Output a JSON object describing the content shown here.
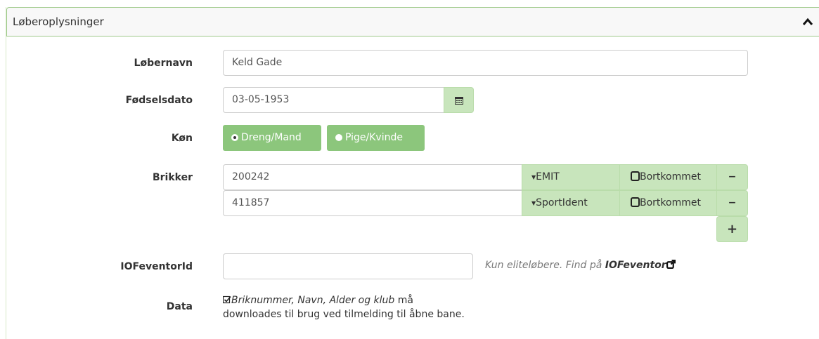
{
  "panel": {
    "title": "Løberoplysninger",
    "collapse_icon": "chevron-up-icon"
  },
  "form": {
    "runner_name": {
      "label": "Løbernavn",
      "value": "Keld Gade"
    },
    "birthdate": {
      "label": "Fødselsdato",
      "value": "03-05-1953",
      "icon": "calendar-icon"
    },
    "gender": {
      "label": "Køn",
      "options": [
        {
          "label": "Dreng/Mand",
          "checked": true
        },
        {
          "label": "Pige/Kvinde",
          "checked": false
        }
      ]
    },
    "chips": {
      "label": "Brikker",
      "rows": [
        {
          "number": "200242",
          "type": "EMIT",
          "lost_label": "Bortkommet"
        },
        {
          "number": "411857",
          "type": "SportIdent",
          "lost_label": "Bortkommet"
        }
      ],
      "remove_symbol": "−",
      "add_symbol": "+"
    },
    "ioffeventor": {
      "label": "IOFeventorId",
      "value": "",
      "help_prefix": "Kun eliteløbere. Find på ",
      "help_link": "IOFeventor"
    },
    "data": {
      "label": "Data",
      "consent_emphasis": "Briknummer, Navn, Alder og klub",
      "consent_rest": " må",
      "consent_line2": "downloades til brug ved tilmelding til åbne bane."
    }
  },
  "colors": {
    "accent": "#8cc67c",
    "addon": "#c8e5bc",
    "border": "#9ec98a"
  }
}
